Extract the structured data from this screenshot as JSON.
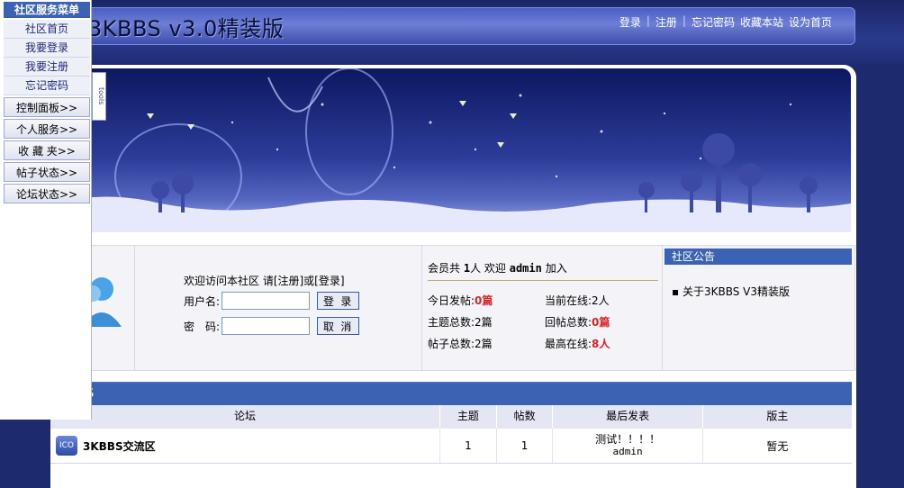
{
  "header": {
    "title": "3KBBS   v3.0精装版",
    "nav": [
      {
        "label": "登录"
      },
      {
        "label": "注册"
      },
      {
        "label": "忘记密码"
      },
      {
        "label": "收藏本站"
      },
      {
        "label": "设为首页"
      }
    ]
  },
  "side_menu": {
    "title": "社区服务菜单",
    "links": [
      "社区首页",
      "我要登录",
      "我要注册",
      "忘记密码"
    ],
    "sections": [
      "控制面板>>",
      "个人服务>>",
      "收 藏 夹>>",
      "帖子状态>>",
      "论坛状态>>"
    ]
  },
  "banner": {
    "tools_label": "tools"
  },
  "login": {
    "welcome": "欢迎访问本社区 请[注册]或[登录]",
    "username_label": "用户名:",
    "password_label": "密　码:",
    "login_button": "登 录",
    "cancel_button": "取 消"
  },
  "stats": {
    "members_prefix": "会员共",
    "members_count": "1",
    "members_mid": "人 欢迎",
    "newest_member": "admin",
    "members_suffix": "加入",
    "today_posts_label": "今日发帖:",
    "today_posts_value": "0篇",
    "online_label": "当前在线:",
    "online_value": "2人",
    "topics_label": "主题总数:",
    "topics_value": "2篇",
    "replies_label": "回帖总数:",
    "replies_value": "0篇",
    "posts_label": "帖子总数:",
    "posts_value": "2篇",
    "max_online_label": "最高在线:",
    "max_online_value": "8人"
  },
  "notice": {
    "title": "社区公告",
    "items": [
      "关于3KBBS V3精装版"
    ]
  },
  "forum": {
    "section_title": "S",
    "columns": [
      "论坛",
      "主题",
      "帖数",
      "最后发表",
      "版主"
    ],
    "rows": [
      {
        "icon_label": "ICO",
        "name": "3KBBS交流区",
        "topics": "1",
        "posts": "1",
        "last_post_title": "测试！！！！",
        "last_post_user": "admin",
        "moderator": "暂无"
      }
    ]
  },
  "colors": {
    "accent": "#3c63b3",
    "header_bg": "#1e2a6e",
    "highlight": "#dd2222"
  }
}
